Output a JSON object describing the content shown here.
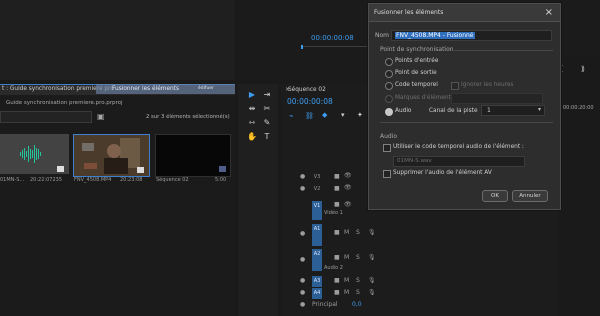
{
  "left_panel": {
    "tab_title": "t : Guide synchronisation premiere pro",
    "project_path": "Guide synchronisation premiere.pro.prproj",
    "selection_count": "2 sur 3 éléments sélectionné(s)",
    "clips": [
      {
        "name": "01MN-S...",
        "duration": "20:22:07235"
      },
      {
        "name": "FNV_4508.MP4",
        "duration": "20:23:08"
      },
      {
        "name": "Séquence 02",
        "duration": "5:00"
      }
    ],
    "ghost_label": "Fusionner les éléments",
    "badge_text": "édifuer"
  },
  "top_monitor": {
    "timecode": "00:00:00:08"
  },
  "timeline": {
    "sequence_name": "Séquence 02",
    "timecode": "00:00:00:08",
    "tracks": [
      {
        "id": "V3",
        "type": "video"
      },
      {
        "id": "V2",
        "type": "video"
      },
      {
        "id": "V1",
        "type": "video",
        "label": "Vidéo 1"
      },
      {
        "id": "A1",
        "type": "audio"
      },
      {
        "id": "A2",
        "type": "audio",
        "label": "Audio 2"
      },
      {
        "id": "A3",
        "type": "audio"
      },
      {
        "id": "A4",
        "type": "audio"
      }
    ],
    "principal_label": "Principal",
    "principal_value": "0,0"
  },
  "right_panel": {
    "ruler_time": "00:00:20:00"
  },
  "dialog": {
    "title": "Fusionner les éléments",
    "name_label": "Nom :",
    "name_value": "FNV_4508.MP4 - Fusionné",
    "sync_section": "Point de synchronisation",
    "options": {
      "in_point": "Points d'entrée",
      "out_point": "Point de sortie",
      "timecode": "Code temporel",
      "ignore_hours": "Ignorer les heures",
      "clip_markers": "Marques d'élément",
      "audio": "Audio",
      "track_channel_label": "Canal de la piste",
      "track_channel_value": "1"
    },
    "audio_section": "Audio",
    "use_audio_timecode": "Utiliser le code temporel audio de l'élément :",
    "audio_source_placeholder": "01MN-S.wav",
    "remove_audio": "Supprimer l'audio de l'élément AV",
    "ok": "OK",
    "cancel": "Annuler"
  }
}
